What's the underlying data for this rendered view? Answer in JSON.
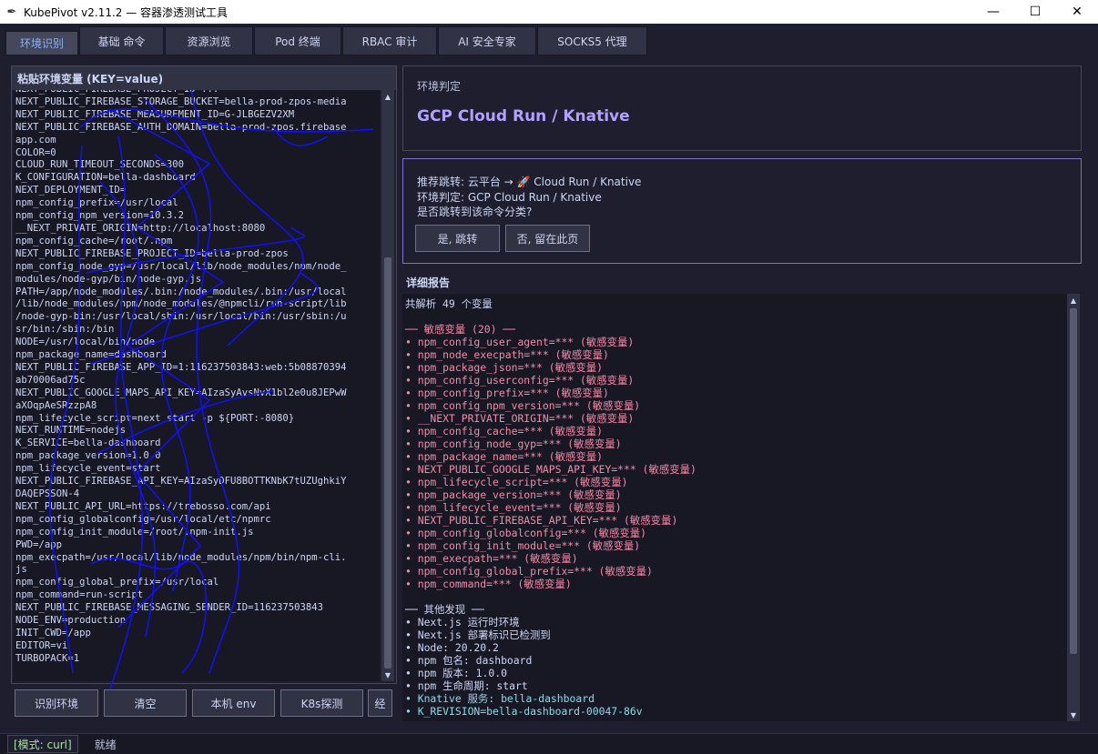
{
  "window": {
    "title": "KubePivot  v2.11.2 — 容器渗透测试工具",
    "icon": "feather-icon"
  },
  "tabs": [
    {
      "label": "环境识别",
      "active": true
    },
    {
      "label": "基础 命令"
    },
    {
      "label": "资源浏览"
    },
    {
      "label": "Pod 终端"
    },
    {
      "label": "RBAC 审计"
    },
    {
      "label": "AI 安全专家"
    },
    {
      "label": "SOCKS5 代理"
    }
  ],
  "left": {
    "title": "粘贴环境变量 (KEY=value)",
    "lines": [
      "NEXT_PUBLIC_FIREBASE_PROJECT_ID=...",
      "NEXT_PUBLIC_FIREBASE_STORAGE_BUCKET=bella-prod-zpos-media",
      "NEXT_PUBLIC_FIREBASE_MEASUREMENT_ID=G-JLBGEZV2XM",
      "NEXT_PUBLIC_FIREBASE_AUTH_DOMAIN=bella-prod-zpos.firebase",
      "app.com",
      "COLOR=0",
      "CLOUD_RUN_TIMEOUT_SECONDS=300",
      "K_CONFIGURATION=bella-dashboard",
      "NEXT_DEPLOYMENT_ID=",
      "npm_config_prefix=/usr/local",
      "npm_config_npm_version=10.3.2",
      "__NEXT_PRIVATE_ORIGIN=http://localhost:8080",
      "npm_config_cache=/root/.npm",
      "NEXT_PUBLIC_FIREBASE_PROJECT_ID=bella-prod-zpos",
      "npm_config_node_gyp=/usr/local/lib/node_modules/npm/node_",
      "modules/node-gyp/bin/node-gyp.js",
      "PATH=/app/node_modules/.bin:/node_modules/.bin:/usr/local",
      "/lib/node_modules/npm/node_modules/@npmcli/run-script/lib",
      "/node-gyp-bin:/usr/local/sbin:/usr/local/bin:/usr/sbin:/u",
      "sr/bin:/sbin:/bin",
      "NODE=/usr/local/bin/node",
      "npm_package_name=dashboard",
      "NEXT_PUBLIC_FIREBASE_APP_ID=1:116237503843:web:5b08870394",
      "ab70006ad75c",
      "NEXT_PUBLIC_GOOGLE_MAPS_API_KEY=AIzaSyAvsNvX1bl2e0u8JEPwW",
      "aXOqpAeSRzzpA8",
      "npm_lifecycle_script=next start -p ${PORT:-8080}",
      "NEXT_RUNTIME=nodejs",
      "K_SERVICE=bella-dashboard",
      "npm_package_version=1.0.0",
      "npm_lifecycle_event=start",
      "NEXT_PUBLIC_FIREBASE_API_KEY=AIzaSyDFU8BOTTKNbK7tUZUghkiY",
      "DAQEPSSON-4",
      "NEXT_PUBLIC_API_URL=https://trebosso.com/api",
      "npm_config_globalconfig=/usr/local/etc/npmrc",
      "npm_config_init_module=/root/.npm-init.js",
      "PWD=/app",
      "npm_execpath=/usr/local/lib/node_modules/npm/bin/npm-cli.",
      "js",
      "npm_config_global_prefix=/usr/local",
      "npm_command=run-script",
      "NEXT_PUBLIC_FIREBASE_MESSAGING_SENDER_ID=116237503843",
      "NODE_ENV=production",
      "INIT_CWD=/app",
      "EDITOR=vi",
      "TURBOPACK=1"
    ],
    "buttons": {
      "detect": "识别环境",
      "clear": "清空",
      "local_env": "本机 env",
      "k8s_probe": "K8s探测",
      "more": "经"
    }
  },
  "verdict": {
    "label": "环境判定",
    "value": "GCP Cloud Run / Knative"
  },
  "recommend": {
    "line1": "推荐跳转: 云平台 → 🚀 Cloud Run / Knative",
    "line2": "环境判定: GCP Cloud Run / Knative",
    "line3": "是否跳转到该命令分类?",
    "yes": "是, 跳转",
    "no": "否, 留在此页"
  },
  "report": {
    "title": "详细报告",
    "lines": [
      {
        "t": "共解析 49 个变量",
        "c": "normal"
      },
      {
        "t": "",
        "c": "normal"
      },
      {
        "t": "── 敏感变量 (20) ──",
        "c": "red"
      },
      {
        "t": "• npm_config_user_agent=*** (敏感变量)",
        "c": "red"
      },
      {
        "t": "• npm_node_execpath=*** (敏感变量)",
        "c": "red"
      },
      {
        "t": "• npm_package_json=*** (敏感变量)",
        "c": "red"
      },
      {
        "t": "• npm_config_userconfig=*** (敏感变量)",
        "c": "red"
      },
      {
        "t": "• npm_config_prefix=*** (敏感变量)",
        "c": "red"
      },
      {
        "t": "• npm_config_npm_version=*** (敏感变量)",
        "c": "red"
      },
      {
        "t": "• __NEXT_PRIVATE_ORIGIN=*** (敏感变量)",
        "c": "red"
      },
      {
        "t": "• npm_config_cache=*** (敏感变量)",
        "c": "red"
      },
      {
        "t": "• npm_config_node_gyp=*** (敏感变量)",
        "c": "red"
      },
      {
        "t": "• npm_package_name=*** (敏感变量)",
        "c": "red"
      },
      {
        "t": "• NEXT_PUBLIC_GOOGLE_MAPS_API_KEY=*** (敏感变量)",
        "c": "red"
      },
      {
        "t": "• npm_lifecycle_script=*** (敏感变量)",
        "c": "red"
      },
      {
        "t": "• npm_package_version=*** (敏感变量)",
        "c": "red"
      },
      {
        "t": "• npm_lifecycle_event=*** (敏感变量)",
        "c": "red"
      },
      {
        "t": "• NEXT_PUBLIC_FIREBASE_API_KEY=*** (敏感变量)",
        "c": "red"
      },
      {
        "t": "• npm_config_globalconfig=*** (敏感变量)",
        "c": "red"
      },
      {
        "t": "• npm_config_init_module=*** (敏感变量)",
        "c": "red"
      },
      {
        "t": "• npm_execpath=*** (敏感变量)",
        "c": "red"
      },
      {
        "t": "• npm_config_global_prefix=*** (敏感变量)",
        "c": "red"
      },
      {
        "t": "• npm_command=*** (敏感变量)",
        "c": "red"
      },
      {
        "t": "",
        "c": "normal"
      },
      {
        "t": "── 其他发现 ──",
        "c": "normal"
      },
      {
        "t": "• Next.js 运行时环境",
        "c": "normal"
      },
      {
        "t": "• Next.js 部署标识已检测到",
        "c": "normal"
      },
      {
        "t": "• Node: 20.20.2",
        "c": "normal"
      },
      {
        "t": "• npm 包名: dashboard",
        "c": "normal"
      },
      {
        "t": "• npm 版本: 1.0.0",
        "c": "normal"
      },
      {
        "t": "• npm 生命周期: start",
        "c": "normal"
      },
      {
        "t": "• Knative 服务: bella-dashboard",
        "c": "cyan"
      },
      {
        "t": "• K_REVISION=bella-dashboard-00047-86v",
        "c": "cyan"
      }
    ]
  },
  "status": {
    "mode": "[模式: curl]",
    "state": "就绪"
  },
  "colors": {
    "accent": "#b4a0ff",
    "sensitive": "#f38ba8",
    "knative": "#89dceb",
    "scribble": "#1010ff"
  }
}
